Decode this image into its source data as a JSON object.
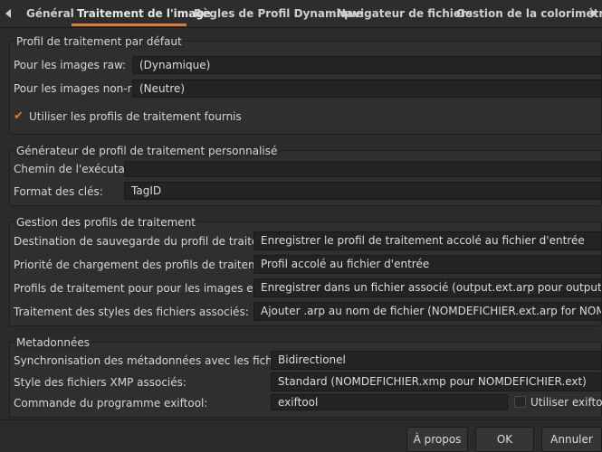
{
  "tabs": [
    "Général",
    "Traitement de l'image",
    "Règles de Profil Dynamique",
    "Navigateur de fichiers",
    "Gestion de la colorimétrie"
  ],
  "default_profile": {
    "title": "Profil de traitement par défaut",
    "raw_label": "Pour les images raw:",
    "raw_value": "(Dynamique)",
    "nonraw_label": "Pour les images non-raw:",
    "nonraw_value": "(Neutre)",
    "use_bundled_label": "Utiliser les profils de traitement fournis"
  },
  "custom_generator": {
    "title": "Générateur de profil de traitement personnalisé",
    "exec_label": "Chemin de l'exécutable:",
    "exec_value": "",
    "keys_label": "Format des clés:",
    "keys_value": "TagID"
  },
  "profile_management": {
    "title": "Gestion des profils de traitement",
    "save_dest_label": "Destination de sauvegarde du profil de traitement:",
    "save_dest_value": "Enregistrer le profil de traitement accolé au fichier d'entrée",
    "load_priority_label": "Priorité de chargement des profils de traitement:",
    "load_priority_value": "Profil accolé au fichier d'entrée",
    "output_profiles_label": "Profils de traitement pour pour les images en sortie:",
    "output_profiles_value": "Enregistrer dans un fichier associé (output.ext.arp pour output.ext)",
    "sidecar_styles_label": "Traitement des styles des fichiers associés:",
    "sidecar_styles_value": "Ajouter .arp au nom de fichier (NOMDEFICHIER.ext.arp for NOMDEFICHIER.ext)"
  },
  "metadata": {
    "title": "Metadonnées",
    "xmp_sync_label": "Synchronisation des métadonnées avec les fichiers XMP :",
    "xmp_sync_value": "Bidirectionel",
    "xmp_style_label": "Style des fichiers XMP associés:",
    "xmp_style_value": "Standard (NOMDEFICHIER.xmp pour NOMDEFICHIER.ext)",
    "exiftool_label": "Commande du programme exiftool:",
    "exiftool_value": "exiftool",
    "use_exiftool_label": "Utiliser exiftool"
  },
  "buttons": {
    "about": "À propos",
    "ok": "OK",
    "cancel": "Annuler"
  }
}
